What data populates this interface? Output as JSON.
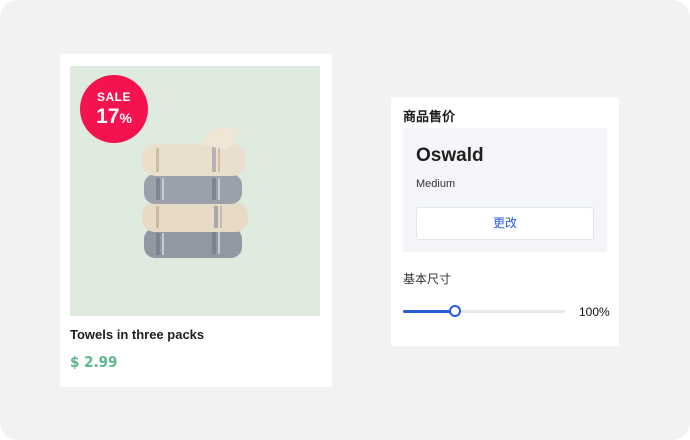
{
  "product": {
    "badge": {
      "label": "SALE",
      "value": "17",
      "unit": "%"
    },
    "name": "Towels in three packs",
    "price": "$ 2.99",
    "image_icon": "towel-stack-icon"
  },
  "settings": {
    "title": "商品售价",
    "font": {
      "name": "Oswald",
      "weight": "Medium",
      "change_label": "更改"
    },
    "size": {
      "label": "基本尺寸",
      "value_text": "100%",
      "slider_fraction": 0.32
    }
  },
  "colors": {
    "sale": "#f5134f",
    "price": "#5bb98a",
    "accent": "#2a5bd7",
    "image_bg": "#deebde"
  }
}
